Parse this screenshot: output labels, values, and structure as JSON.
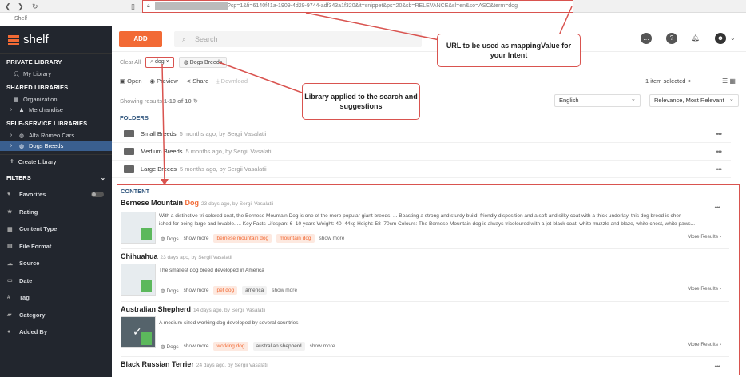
{
  "browser": {
    "url": "?cp=1&fi=6140f41a-1909-4d29-9744-adf343a1f320&it=snippet&ps=20&sb=RELEVANCE&sl=en&so=ASC&term=dog",
    "tab_title": "Shelf"
  },
  "sidebar": {
    "logo": "shelf",
    "private_header": "PRIVATE LIBRARY",
    "private_items": [
      {
        "label": "My Library"
      }
    ],
    "shared_header": "SHARED LIBRARIES",
    "shared_items": [
      {
        "label": "Organization"
      },
      {
        "label": "Merchandise"
      }
    ],
    "self_header": "SELF-SERVICE LIBRARIES",
    "self_items": [
      {
        "label": "Alfa Romeo Cars"
      },
      {
        "label": "Dogs Breeds"
      }
    ],
    "create_library": "Create Library",
    "filters_header": "FILTERS",
    "filters": [
      {
        "label": "Favorites",
        "icon": "heart-icon"
      },
      {
        "label": "Rating",
        "icon": "star-icon"
      },
      {
        "label": "Content Type",
        "icon": "grid-icon"
      },
      {
        "label": "File Format",
        "icon": "file-icon"
      },
      {
        "label": "Source",
        "icon": "cloud-icon"
      },
      {
        "label": "Date",
        "icon": "calendar-icon"
      },
      {
        "label": "Tag",
        "icon": "hash-icon"
      },
      {
        "label": "Category",
        "icon": "folder-icon"
      },
      {
        "label": "Added By",
        "icon": "user-icon"
      }
    ]
  },
  "topbar": {
    "add_label": "ADD",
    "search_placeholder": "Search"
  },
  "filterbar": {
    "clear_all": "Clear All",
    "term_chip": "dog",
    "library_chip": "Dogs Breeds"
  },
  "actions": {
    "open": "Open",
    "preview": "Preview",
    "share": "Share",
    "download": "Download"
  },
  "selection": {
    "info": "1 item selected"
  },
  "results": {
    "prefix": "Showing results",
    "range": "1-10 of 10"
  },
  "language": "English",
  "sort": "Relevance, Most Relevant",
  "folders": {
    "header": "FOLDERS",
    "items": [
      {
        "name": "Small Breeds",
        "meta": "5 months ago, by Sergii Vasalatii"
      },
      {
        "name": "Medium Breeds",
        "meta": "5 months ago, by Sergii Vasalatii"
      },
      {
        "name": "Large Breeds",
        "meta": "5 months ago, by Sergii Vasalatii"
      }
    ]
  },
  "content": {
    "header": "CONTENT",
    "show_more": "show more",
    "more_results": "More Results",
    "library_tag": "Dogs",
    "items": [
      {
        "title": "Bernese Mountain",
        "title_hl": "Dog",
        "meta": "23 days ago, by Sergii Vasalatii",
        "desc1": "With a distinctive tri-colored coat, the Bernese Mountain Dog is one of the more popular giant breeds. ... Boasting a strong and sturdy build, friendly disposition and a soft and silky coat with a thick underlay, this dog breed is cher-",
        "desc2": "ished for being large and lovable. ... Key Facts Lifespan: 6–10 years Weight: 40–44kg Height: 58–70cm Colours: The Bernese Mountain dog is always tricoloured with a jet-black coat, white muzzle and blaze, white chest, white paws...",
        "tags": [
          "bernese mountain dog",
          "mountain dog"
        ]
      },
      {
        "title": "Chihuahua",
        "title_hl": "",
        "meta": "23 days ago, by Sergii Vasalatii",
        "desc1": "The smallest dog breed developed in America",
        "desc2": "",
        "tags": [
          "pet dog",
          "america"
        ]
      },
      {
        "title": "Australian Shepherd",
        "title_hl": "",
        "meta": "14 days ago, by Sergii Vasalatii",
        "desc1": "A medium-sized working dog developed by several countries",
        "desc2": "",
        "tags": [
          "working dog",
          "australian shepherd"
        ]
      },
      {
        "title": "Black Russian Terrier",
        "title_hl": "",
        "meta": "24 days ago, by Sergii Vasalatii",
        "desc1": "",
        "desc2": "",
        "tags": []
      }
    ]
  },
  "callouts": {
    "url": "URL to be used as mappingValue for your Intent",
    "library": "Library applied to the search and suggestions"
  },
  "colors": {
    "accent": "#f26a35",
    "sidebar_bg": "#22262e",
    "annotation": "#d9534f",
    "active": "#3a5f8f"
  }
}
